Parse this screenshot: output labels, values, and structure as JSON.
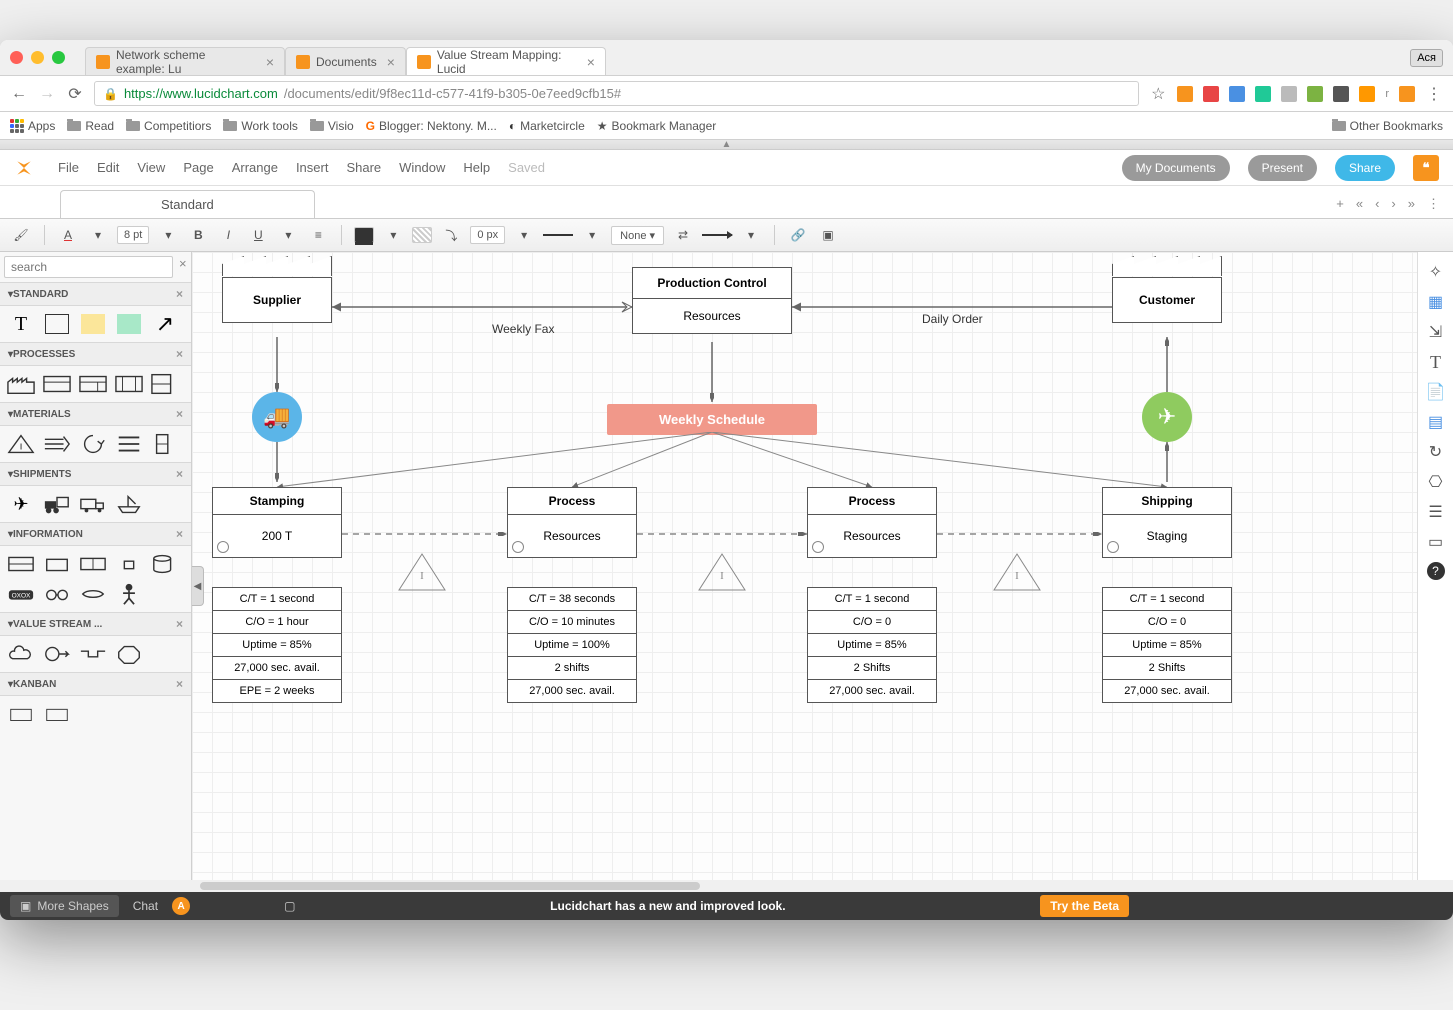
{
  "browser": {
    "tabs": [
      {
        "title": "Network scheme example: Lu"
      },
      {
        "title": "Documents"
      },
      {
        "title": "Value Stream Mapping: Lucid",
        "active": true
      }
    ],
    "user_badge": "Ася",
    "url_host": "https://www.lucidchart.com",
    "url_path": "/documents/edit/9f8ec11d-c577-41f9-b305-0e7eed9cfb15#",
    "bookmarks": [
      "Apps",
      "Read",
      "Competitiors",
      "Work tools",
      "Visio",
      "Blogger: Nektony. M...",
      "Marketcircle",
      "Bookmark Manager"
    ],
    "other_bm": "Other Bookmarks"
  },
  "app": {
    "menu": [
      "File",
      "Edit",
      "View",
      "Page",
      "Arrange",
      "Insert",
      "Share",
      "Window",
      "Help"
    ],
    "saved": "Saved",
    "buttons": {
      "docs": "My Documents",
      "present": "Present",
      "share": "Share"
    },
    "doctab": "Standard",
    "toolbar": {
      "font_size": "8 pt",
      "line_w": "0 px",
      "line_style": "None"
    }
  },
  "sidebar": {
    "search_placeholder": "search",
    "sections": {
      "standard": "STANDARD",
      "processes": "PROCESSES",
      "materials": "MATERIALS",
      "shipments": "SHIPMENTS",
      "information": "INFORMATION",
      "vsm": "VALUE STREAM ...",
      "kanban": "KANBAN"
    }
  },
  "canvas": {
    "supplier": "Supplier",
    "customer": "Customer",
    "control_title": "Production Control",
    "control_res": "Resources",
    "weekly_fax": "Weekly Fax",
    "daily_order": "Daily Order",
    "schedule": "Weekly Schedule",
    "inv_label": "I",
    "proc": [
      {
        "name": "Stamping",
        "res": "200 T"
      },
      {
        "name": "Process",
        "res": "Resources"
      },
      {
        "name": "Process",
        "res": "Resources"
      },
      {
        "name": "Shipping",
        "res": "Staging"
      }
    ],
    "data": [
      [
        "C/T = 1 second",
        "C/O = 1 hour",
        "Uptime = 85%",
        "27,000 sec. avail.",
        "EPE = 2 weeks"
      ],
      [
        "C/T = 38 seconds",
        "C/O = 10 minutes",
        "Uptime = 100%",
        "2 shifts",
        "27,000 sec. avail."
      ],
      [
        "C/T = 1 second",
        "C/O = 0",
        "Uptime = 85%",
        "2 Shifts",
        "27,000 sec. avail."
      ],
      [
        "C/T = 1 second",
        "C/O = 0",
        "Uptime = 85%",
        "2 Shifts",
        "27,000 sec. avail."
      ]
    ]
  },
  "bottom": {
    "more": "More Shapes",
    "chat": "Chat",
    "chat_initial": "A",
    "banner": "Lucidchart has a new and improved look.",
    "beta": "Try the Beta"
  }
}
